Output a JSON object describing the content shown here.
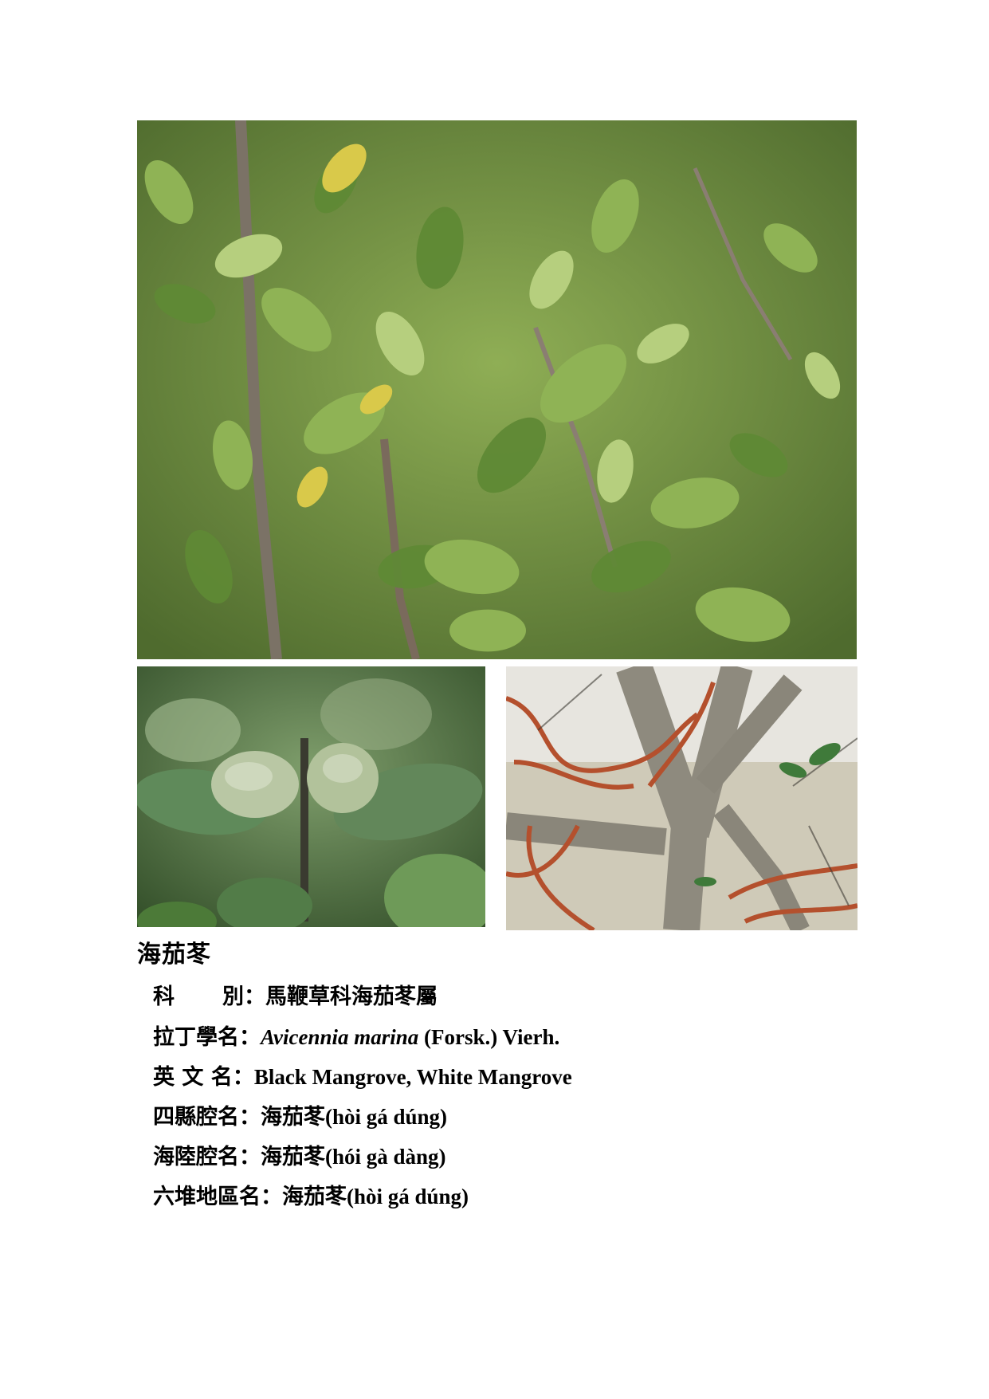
{
  "plant": {
    "name": "海茄苳",
    "rows": [
      {
        "label_a": "科",
        "label_b": "別：",
        "value": "馬鞭草科海茄苳屬"
      },
      {
        "label": "拉丁學名：",
        "latin_italic": "Avicennia marina",
        "latin_rest": " (Forsk.) Vierh."
      },
      {
        "label": "英 文 名：",
        "value": "Black Mangrove, White Mangrove"
      },
      {
        "label": "四縣腔名：",
        "zh": "海茄苳",
        "roman": "(hòi gá dúng)"
      },
      {
        "label": "海陸腔名：",
        "zh": "海茄苳",
        "roman": "(hói gà dàng)"
      },
      {
        "label": "六堆地區名：",
        "zh": "海茄苳",
        "roman": "(hòi gá dúng)"
      }
    ]
  },
  "photos": {
    "main": "leaves-photo",
    "fruit": "fruit-photo",
    "trunk": "trunk-photo"
  }
}
